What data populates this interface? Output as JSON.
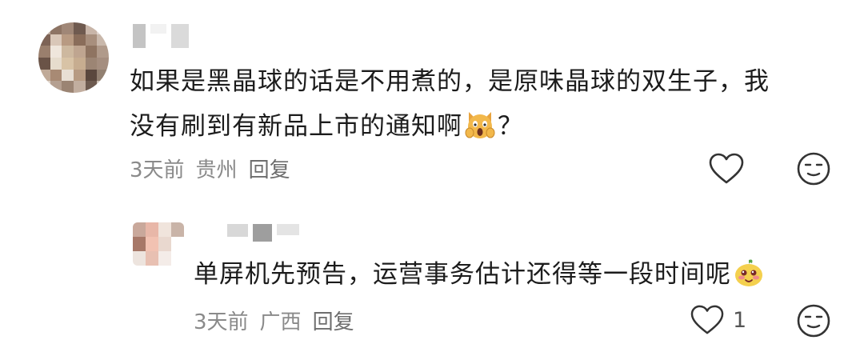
{
  "comment": {
    "text_line1": "如果是黑晶球的话是不用煮的，是原味晶球的双生子，我",
    "text_line2": "没有刷到有新品上市的通知啊",
    "text_suffix": "？",
    "emoji": "screaming-cat-emoji",
    "time": "3天前",
    "location": "贵州",
    "reply_label": "回复",
    "like_icon": "heart-outline-icon",
    "dislike_icon": "neutral-face-icon"
  },
  "reply": {
    "text": "单屏机先预告，运营事务估计还得等一段时间呢",
    "emoji": "blushing-face-emoji",
    "time": "3天前",
    "location": "广西",
    "reply_label": "回复",
    "like_count": "1",
    "like_icon": "heart-outline-icon",
    "dislike_icon": "neutral-face-icon"
  }
}
